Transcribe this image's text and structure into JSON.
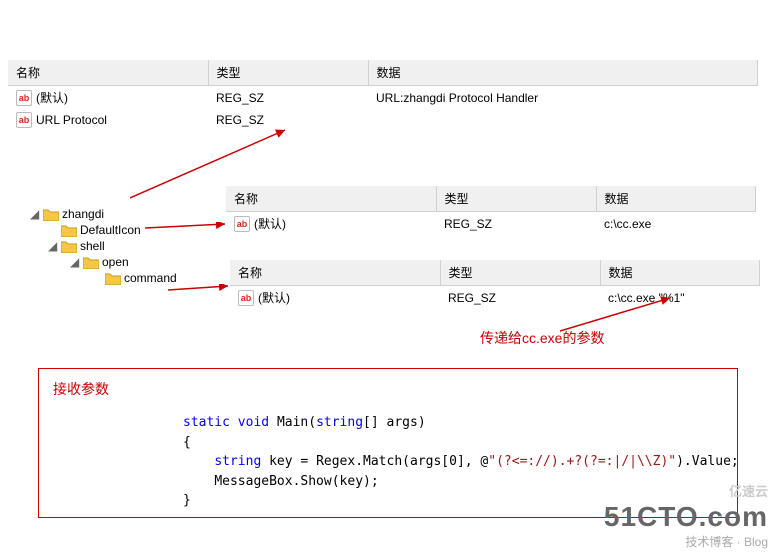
{
  "headers": {
    "name": "名称",
    "type": "类型",
    "data": "数据"
  },
  "topTable": {
    "rows": [
      {
        "name": "(默认)",
        "type": "REG_SZ",
        "data": "URL:zhangdi Protocol Handler"
      },
      {
        "name": "URL Protocol",
        "type": "REG_SZ",
        "data": ""
      }
    ]
  },
  "tree": {
    "items": [
      {
        "label": "zhangdi",
        "level": 1,
        "expanded": true
      },
      {
        "label": "DefaultIcon",
        "level": 2,
        "expanded": false
      },
      {
        "label": "shell",
        "level": 2,
        "expanded": true
      },
      {
        "label": "open",
        "level": 3,
        "expanded": true
      },
      {
        "label": "command",
        "level": 4,
        "expanded": false
      }
    ]
  },
  "midTable": {
    "rows": [
      {
        "name": "(默认)",
        "type": "REG_SZ",
        "data": "c:\\cc.exe"
      }
    ]
  },
  "botTable": {
    "rows": [
      {
        "name": "(默认)",
        "type": "REG_SZ",
        "data": "c:\\cc.exe \"%1\""
      }
    ]
  },
  "annotation": {
    "param": "传递给cc.exe的参数"
  },
  "codeBox": {
    "title": "接收参数",
    "line1_kw1": "static",
    "line1_kw2": "void",
    "line1_fn": "Main(",
    "line1_kw3": "string",
    "line1_rest": "[] args)",
    "line2": "{",
    "line3_kw": "string",
    "line3_mid": " key = Regex.Match(args[",
    "line3_idx": "0",
    "line3_mid2": "], @",
    "line3_str": "\"(?<=://).+?(?=:|/|\\\\Z)\"",
    "line3_end": ").Value;",
    "line4": "MessageBox.Show(key);",
    "line5": "}"
  },
  "watermark": {
    "main": "51CTO.com",
    "sub": "技术博客 · Blog",
    "brand": "亿速云"
  }
}
